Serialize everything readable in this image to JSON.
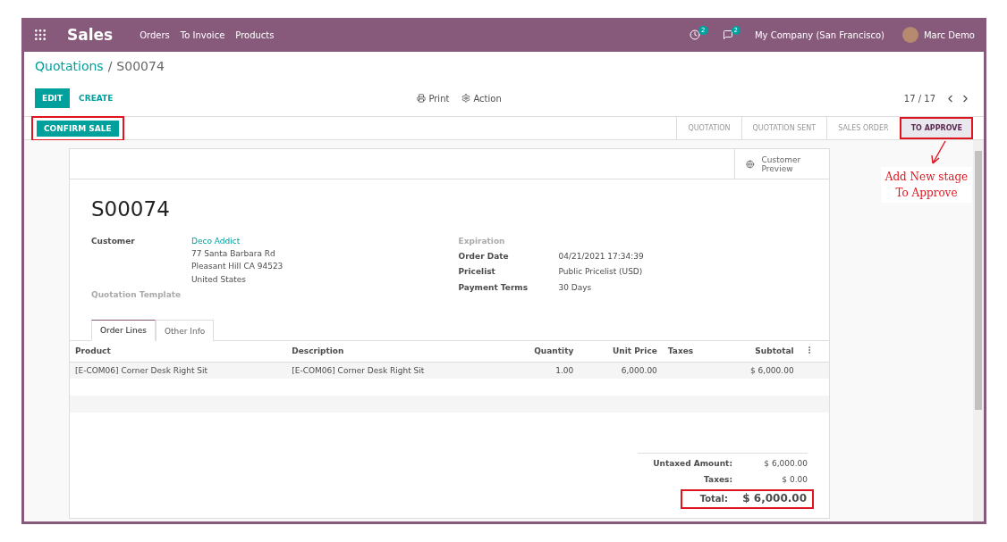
{
  "navbar": {
    "app": "Sales",
    "menu": [
      "Orders",
      "To Invoice",
      "Products"
    ],
    "activity_count": "2",
    "message_count": "2",
    "company": "My Company (San Francisco)",
    "user": "Marc Demo"
  },
  "breadcrumb": {
    "parent": "Quotations",
    "separator": "/",
    "current": "S00074"
  },
  "actions": {
    "edit": "EDIT",
    "create": "CREATE",
    "print": "Print",
    "action": "Action",
    "pager": "17 / 17"
  },
  "statusbar": {
    "button": "CONFIRM SALE",
    "stages": [
      {
        "label": "QUOTATION",
        "selected": false
      },
      {
        "label": "QUOTATION SENT",
        "selected": false
      },
      {
        "label": "SALES ORDER",
        "selected": false
      },
      {
        "label": "TO APPROVE",
        "selected": true
      }
    ]
  },
  "annotation": {
    "note": "Add New stage To Approve"
  },
  "sheet": {
    "preview": "Customer Preview",
    "name": "S00074",
    "left_fields": [
      {
        "label": "Customer",
        "kind": "address",
        "value": "Deco Addict",
        "lines": [
          "77 Santa Barbara Rd",
          "Pleasant Hill CA 94523",
          "United States"
        ]
      },
      {
        "label": "Quotation Template",
        "kind": "empty"
      }
    ],
    "right_fields": [
      {
        "label": "Expiration",
        "kind": "empty"
      },
      {
        "label": "Order Date",
        "kind": "text",
        "value": "04/21/2021 17:34:39"
      },
      {
        "label": "Pricelist",
        "kind": "text",
        "value": "Public Pricelist (USD)"
      },
      {
        "label": "Payment Terms",
        "kind": "text",
        "value": "30 Days"
      }
    ],
    "tabs": [
      {
        "label": "Order Lines",
        "selected": true
      },
      {
        "label": "Other Info",
        "selected": false
      }
    ],
    "table": {
      "columns": [
        "Product",
        "Description",
        "Quantity",
        "Unit Price",
        "Taxes",
        "Subtotal"
      ],
      "rows": [
        [
          "[E-COM06] Corner Desk Right Sit",
          "[E-COM06] Corner Desk Right Sit",
          "1.00",
          "6,000.00",
          "",
          "$ 6,000.00"
        ]
      ]
    },
    "totals": [
      {
        "label": "Untaxed Amount:",
        "value": "$ 6,000.00"
      },
      {
        "label": "Taxes:",
        "value": "$ 0.00"
      }
    ],
    "total": {
      "label": "Total:",
      "value": "$ 6,000.00"
    }
  }
}
